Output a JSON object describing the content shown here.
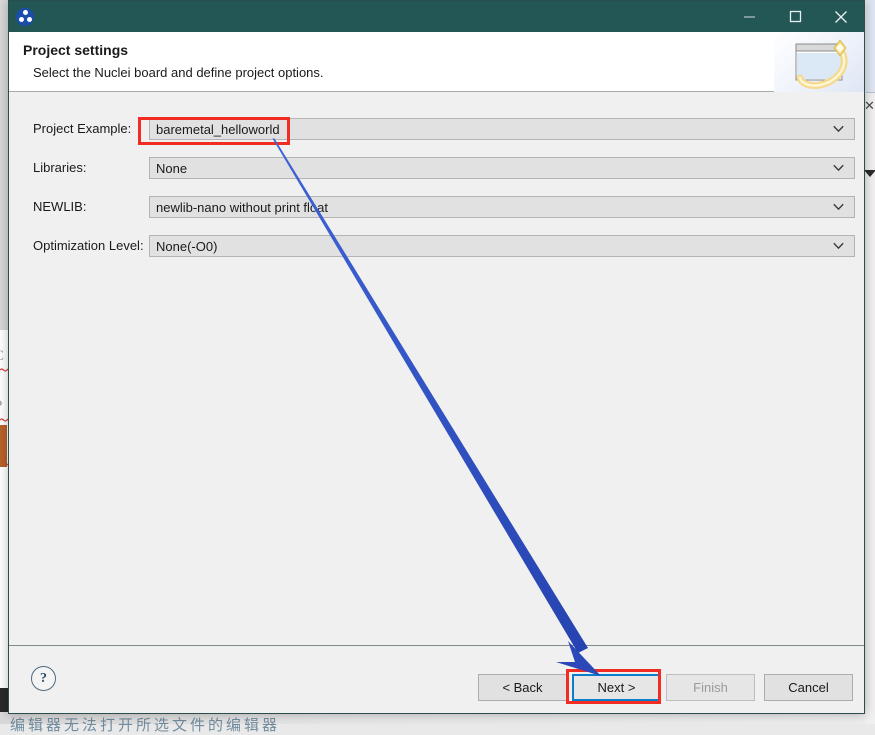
{
  "window": {
    "app_icon": "nuclei-logo-icon",
    "titlebar_color": "#235755",
    "controls": [
      {
        "name": "minimize",
        "glyph": "minimize-icon"
      },
      {
        "name": "maximize",
        "glyph": "maximize-icon"
      },
      {
        "name": "close",
        "glyph": "close-icon"
      }
    ]
  },
  "header": {
    "title": "Project settings",
    "subtitle": "Select the Nuclei board and define project options.",
    "banner_icon": "wizard-window-sparkle-icon"
  },
  "form": {
    "fields": [
      {
        "label": "Project Example:",
        "value": "baremetal_helloworld",
        "highlighted": true
      },
      {
        "label": "Libraries:",
        "value": "None",
        "highlighted": false
      },
      {
        "label": "NEWLIB:",
        "value": "newlib-nano without print float",
        "highlighted": false
      },
      {
        "label": "Optimization Level:",
        "value": "None(-O0)",
        "highlighted": false
      }
    ]
  },
  "footer": {
    "help_glyph": "?",
    "buttons": [
      {
        "label": "< Back",
        "state": "enabled"
      },
      {
        "label": "Next >",
        "state": "focused"
      },
      {
        "label": "Finish",
        "state": "disabled"
      },
      {
        "label": "Cancel",
        "state": "enabled"
      }
    ]
  },
  "annotations": {
    "arrow_color": "#2f55c4",
    "box_color": "#f22c23",
    "arrow_from": "baremetal_helloworld field",
    "arrow_to": "Next > button"
  },
  "background": {
    "left_fragment_lines": [
      "C",
      "P",
      "n"
    ],
    "bottom_strip_text": "编辑器无法打开所选文件的编辑器"
  }
}
